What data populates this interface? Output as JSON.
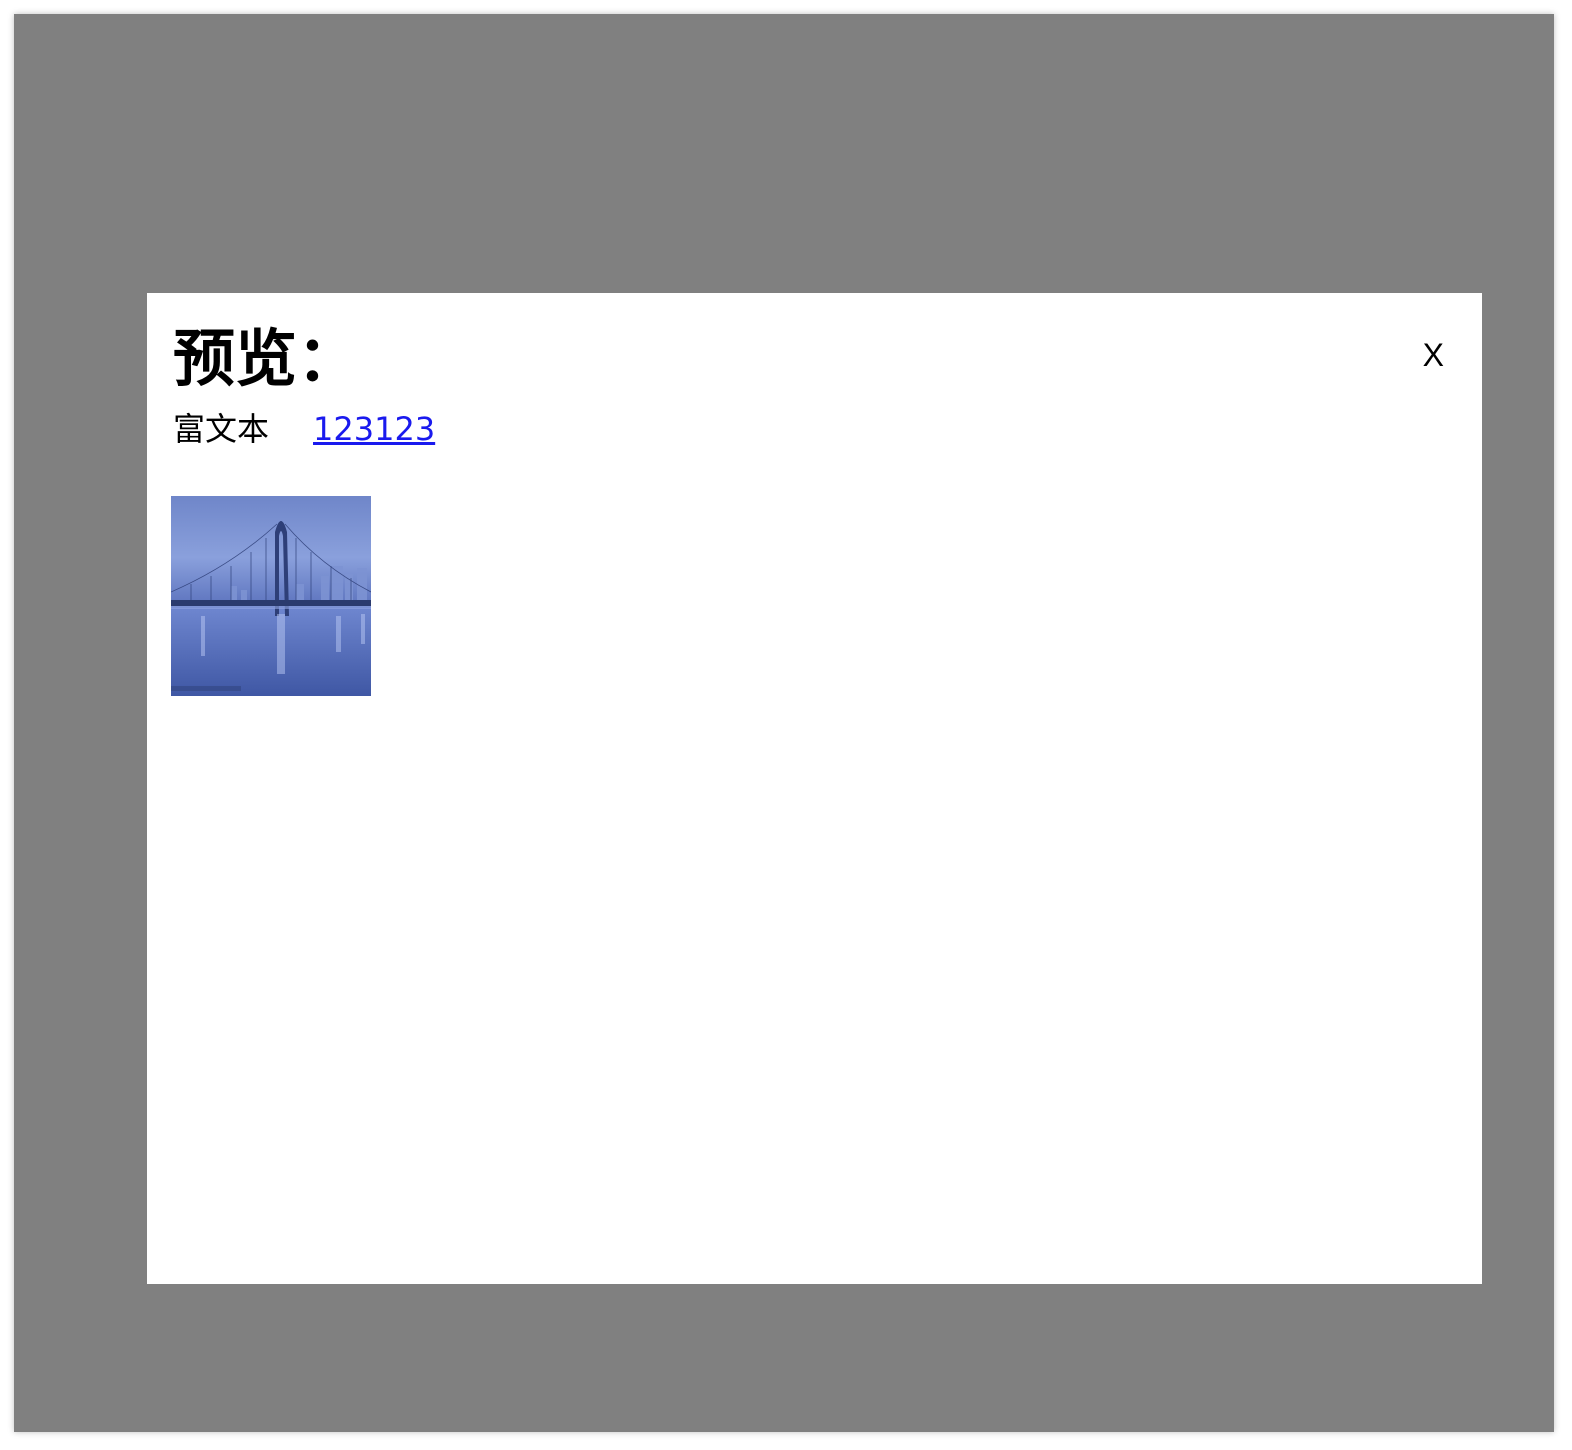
{
  "modal": {
    "title": "预览：",
    "close_label": "X",
    "rich_text_label": "富文本",
    "link_text": "123123",
    "image": {
      "alt": "bridge over river at dusk",
      "tone_color": "#5b72bd"
    }
  },
  "colors": {
    "overlay": "#808080",
    "link": "#1a1aee"
  }
}
